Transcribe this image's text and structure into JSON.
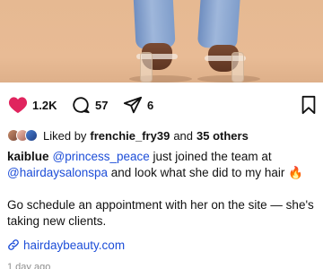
{
  "post": {
    "likes": "1.2K",
    "comments": "57",
    "shares": "6",
    "liked_by_prefix": "Liked by",
    "liked_by_user": "frenchie_fry39",
    "liked_by_and": "and",
    "liked_by_others": "35 others",
    "caption": {
      "username": "kaiblue",
      "mention1": "@princess_peace",
      "text1": " just joined the team at ",
      "mention2": "@hairdaysalonspa",
      "text2": " and look what she did to my hair 🔥",
      "para2": "Go schedule an appointment with her on the site — she's taking new clients."
    },
    "link": "hairdaybeauty.com",
    "timestamp": "1 day ago"
  },
  "colors": {
    "like": "#e0245e",
    "link": "#1d4ed8",
    "muted": "#8e8e8e"
  },
  "icons": [
    "heart-icon",
    "comment-icon",
    "share-icon",
    "bookmark-icon",
    "link-icon"
  ]
}
